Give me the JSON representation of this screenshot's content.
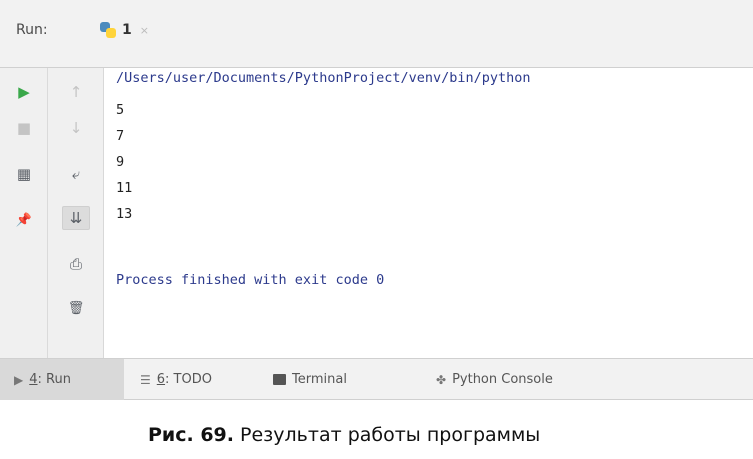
{
  "run_header": {
    "label": "Run:",
    "tab": {
      "label": "1",
      "close": "×",
      "icon": "python-file-icon"
    }
  },
  "toolbar_left": [
    {
      "name": "rerun-button",
      "icon": "play-icon",
      "glyph": "▶"
    },
    {
      "name": "stop-button",
      "icon": "stop-icon",
      "glyph": "■"
    },
    {
      "name": "layout-button",
      "icon": "layout-icon",
      "glyph": "▦"
    },
    {
      "name": "pin-button",
      "icon": "pin-icon",
      "glyph": "📌"
    }
  ],
  "toolbar_mid": [
    {
      "name": "up-button",
      "icon": "arrow-up-icon",
      "glyph": "↑"
    },
    {
      "name": "down-button",
      "icon": "arrow-down-icon",
      "glyph": "↓"
    },
    {
      "name": "soft-wrap-button",
      "icon": "soft-wrap-icon",
      "glyph": "⤶"
    },
    {
      "name": "scroll-to-end-button",
      "icon": "scroll-to-end-icon",
      "glyph": "⇊"
    },
    {
      "name": "print-button",
      "icon": "print-icon",
      "glyph": "⎙"
    },
    {
      "name": "clear-button",
      "icon": "trash-icon",
      "glyph": "🗑"
    }
  ],
  "console": {
    "command": "/Users/user/Documents/PythonProject/venv/bin/python",
    "output": [
      "5",
      "7",
      "9",
      "11",
      "13"
    ],
    "exit_message": "Process finished with exit code 0"
  },
  "bottom_tabs": [
    {
      "prefix": "4",
      "label": ": Run",
      "icon": "run-icon"
    },
    {
      "prefix": "6",
      "label": ": TODO",
      "icon": "todo-icon"
    },
    {
      "prefix": "",
      "label": "Terminal",
      "icon": "terminal-icon"
    },
    {
      "prefix": "",
      "label": "Python Console",
      "icon": "python-console-icon"
    }
  ],
  "caption": {
    "bold": "Рис. 69.",
    "text": " Результат работы программы"
  },
  "colors": {
    "green": "#3aa84a",
    "path_blue": "#2c3a8c"
  }
}
